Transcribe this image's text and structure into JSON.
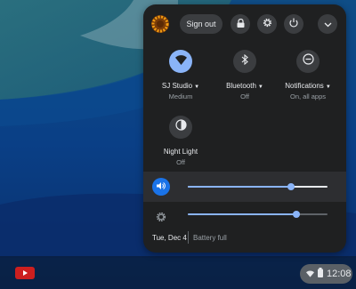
{
  "system_tray": {
    "sign_out_label": "Sign out",
    "top_icons": [
      "lock-icon",
      "gear-icon",
      "power-icon",
      "chevron-down-icon"
    ],
    "tiles": [
      {
        "label": "SJ Studio",
        "sublabel": "Medium",
        "icon": "wifi-icon",
        "active": true,
        "has_dropdown": true
      },
      {
        "label": "Bluetooth",
        "sublabel": "Off",
        "icon": "bluetooth-icon",
        "active": false,
        "has_dropdown": true
      },
      {
        "label": "Notifications",
        "sublabel": "On, all apps",
        "icon": "notifications-icon",
        "active": false,
        "has_dropdown": true
      },
      {
        "label": "Night Light",
        "sublabel": "Off",
        "icon": "night-light-icon",
        "active": false,
        "has_dropdown": false
      }
    ],
    "volume_level": 0.74,
    "brightness_level": 0.78,
    "date": "Tue, Dec 4",
    "battery_status": "Battery full"
  },
  "shelf": {
    "time": "12:08",
    "app_icon": "youtube-icon"
  },
  "colors": {
    "accent": "#8ab4f8",
    "accent_strong": "#1a73e8",
    "panel_bg": "#1f2021",
    "youtube_red": "#cc1f1f"
  }
}
